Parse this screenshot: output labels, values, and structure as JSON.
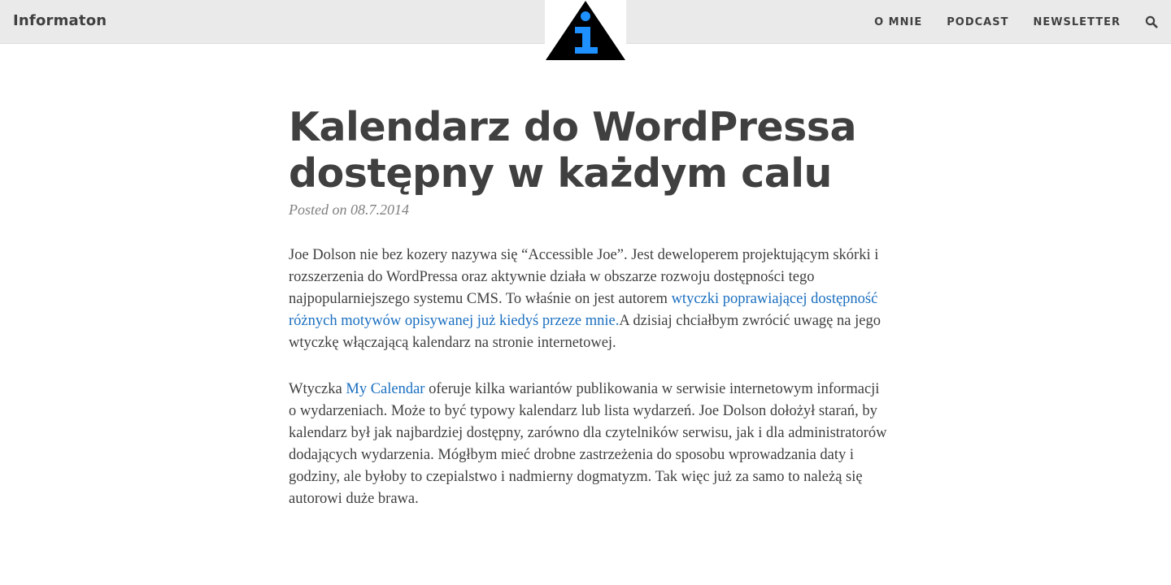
{
  "site": {
    "brand": "Informaton"
  },
  "nav": {
    "items": [
      {
        "label": "O MNIE"
      },
      {
        "label": "PODCAST"
      },
      {
        "label": "NEWSLETTER"
      }
    ],
    "search_icon": "search-icon"
  },
  "logo": {
    "icon": "info-triangle-logo",
    "triangle_color": "#000000",
    "symbol_color": "#1e90ff"
  },
  "post": {
    "title_line1": "Kalendarz do WordPressa",
    "title_line2": "dostępny w każdym calu",
    "meta_prefix": "Posted on",
    "date": "08.7.2014",
    "p1_text1": "Joe Dolson nie bez kozery nazywa się “Accessible Joe”. Jest deweloperem projektującym skórki i rozszerzenia do WordPressa oraz aktywnie działa w obszarze rozwoju dostępności tego najpopularniejszego systemu CMS. To właśnie on jest autorem ",
    "p1_link": "wtyczki poprawiającej dostępność różnych motywów opisywanej już kiedyś przeze mnie.",
    "p1_text2": "A dzisiaj chciałbym zwrócić uwagę na jego wtyczkę włączającą kalendarz na stronie internetowej.",
    "p2_text1": "Wtyczka ",
    "p2_link": "My Calendar",
    "p2_text2": " oferuje kilka wariantów publikowania w serwisie internetowym informacji o wydarzeniach. Może to być typowy kalendarz lub lista wydarzeń. Joe Dolson dołożył starań, by kalendarz był jak najbardziej dostępny, zarówno dla czytelników serwisu, jak i dla administratorów dodających wydarzenia. Mógłbym mieć drobne zastrzeżenia do sposobu wprowadzania daty i godziny, ale byłoby to czepialstwo i nadmierny dogmatyzm. Tak więc już za samo to należą się autorowi duże brawa."
  },
  "colors": {
    "link": "#1a6fc0",
    "nav_bg": "#eaeaea",
    "text": "#404040"
  }
}
